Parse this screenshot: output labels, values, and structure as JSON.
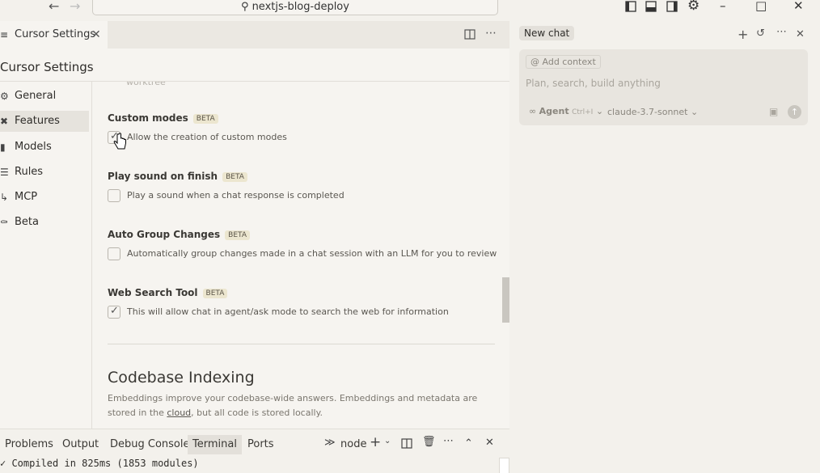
{
  "titlebar": {
    "back_icon": "arrow-left-icon",
    "forward_icon": "arrow-right-icon",
    "search_text": "nextjs-blog-deploy",
    "layout_icons": [
      "toggle-primary-sidebar-icon",
      "toggle-panel-icon",
      "toggle-secondary-sidebar-icon",
      "gear-icon"
    ],
    "window_controls": [
      "minimize-icon",
      "maximize-icon",
      "close-icon"
    ]
  },
  "editor_tab": {
    "label": "Cursor Settings",
    "icon": "settings-sliders-icon"
  },
  "settings": {
    "title": "Cursor Settings",
    "sidebar": [
      {
        "label": "General",
        "icon": "gear-icon"
      },
      {
        "label": "Features",
        "icon": "tools-icon",
        "active": true
      },
      {
        "label": "Models",
        "icon": "bar-chart-icon"
      },
      {
        "label": "Rules",
        "icon": "list-icon"
      },
      {
        "label": "MCP",
        "icon": "plug-icon"
      },
      {
        "label": "Beta",
        "icon": "flask-icon"
      }
    ],
    "faded_text": "worktree",
    "options": [
      {
        "title": "Custom modes",
        "badge": "BETA",
        "desc": "Allow the creation of custom modes",
        "checked": true
      },
      {
        "title": "Play sound on finish",
        "badge": "BETA",
        "desc": "Play a sound when a chat response is completed",
        "checked": false
      },
      {
        "title": "Auto Group Changes",
        "badge": "BETA",
        "desc": "Automatically group changes made in a chat session with an LLM for you to review",
        "checked": false
      },
      {
        "title": "Web Search Tool",
        "badge": "BETA",
        "desc": "This will allow chat in agent/ask mode to search the web for information",
        "checked": true
      }
    ],
    "section": {
      "title": "Codebase Indexing",
      "desc_before": "Embeddings improve your codebase-wide answers. Embeddings and metadata are stored in the ",
      "desc_link": "cloud",
      "desc_after": ", but all code is stored locally."
    }
  },
  "panel": {
    "tabs": [
      "Problems",
      "Output",
      "Debug Console",
      "Terminal",
      "Ports"
    ],
    "active_tab": "Terminal",
    "terminal_name": "node",
    "terminal_line": "✓ Compiled in 825ms (1853 modules)"
  },
  "chat": {
    "new_chat_label": "New chat",
    "add_context": "Add context",
    "placeholder": "Plan, search, build anything",
    "agent_label": "Agent",
    "agent_shortcut": "Ctrl+I",
    "model": "claude-3.7-sonnet"
  }
}
